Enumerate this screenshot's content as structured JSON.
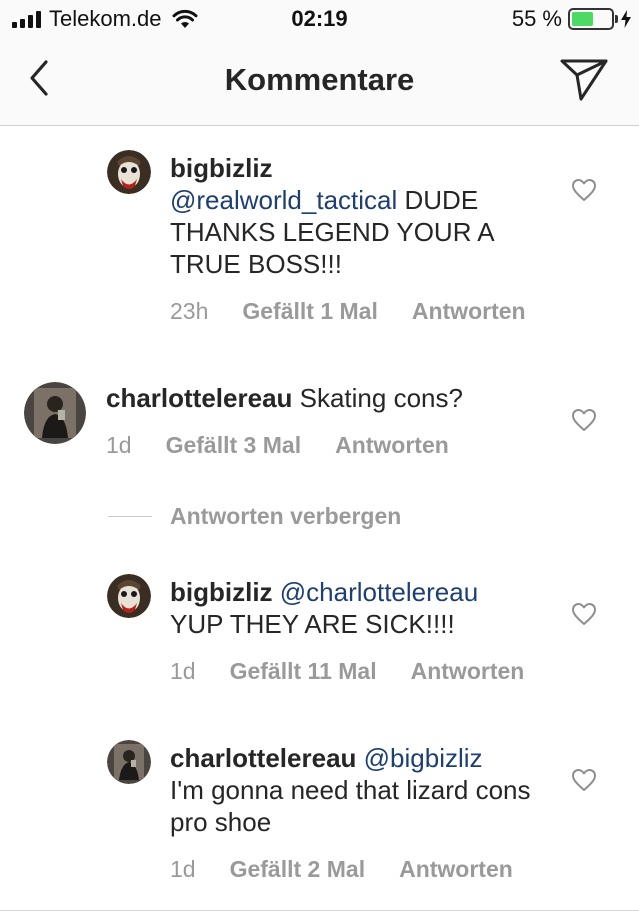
{
  "status_bar": {
    "carrier": "Telekom.de",
    "time": "02:19",
    "battery_percent": "55 %",
    "battery_level": 0.55
  },
  "header": {
    "title": "Kommentare"
  },
  "comments": [
    {
      "username": "bigbizliz",
      "mention": "@realworld_tactical",
      "text": " DUDE THANKS LEGEND YOUR A TRUE BOSS!!!",
      "time": "23h",
      "likes": "Gefällt 1 Mal",
      "reply": "Antworten"
    },
    {
      "username": "charlottelereau",
      "mention": "",
      "text": " Skating cons?",
      "time": "1d",
      "likes": "Gefällt 3 Mal",
      "reply": "Antworten"
    },
    {
      "username": "bigbizliz",
      "mention": "@charlottelereau",
      "text": " YUP THEY ARE SICK!!!!",
      "time": "1d",
      "likes": "Gefällt 11 Mal",
      "reply": "Antworten"
    },
    {
      "username": "charlottelereau",
      "mention": "@bigbizliz",
      "text": " I'm gonna need that lizard cons pro shoe",
      "time": "1d",
      "likes": "Gefällt 2 Mal",
      "reply": "Antworten"
    }
  ],
  "hide_replies": "Antworten verbergen",
  "colors": {
    "mention": "#1e3f72",
    "meta": "#9a9a9a",
    "battery": "#4cd964"
  },
  "icons": [
    "signal-icon",
    "wifi-icon",
    "battery-icon",
    "charging-bolt-icon",
    "back-chevron-icon",
    "direct-send-icon",
    "heart-icon"
  ]
}
